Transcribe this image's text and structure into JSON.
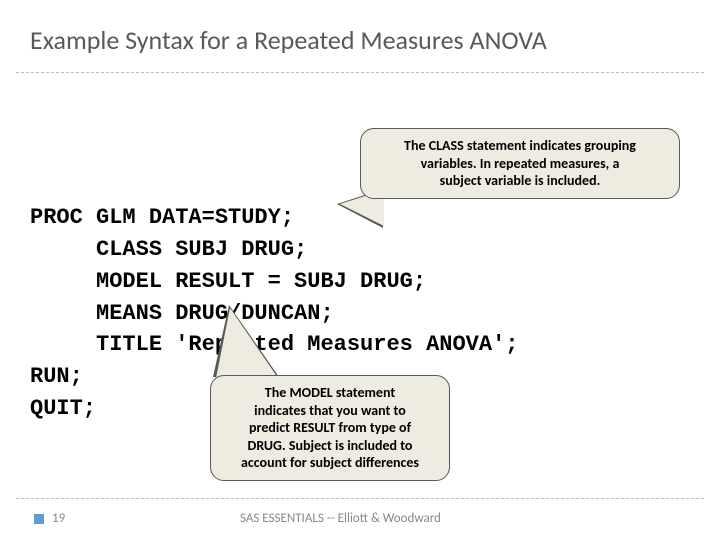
{
  "title": "Example Syntax for a Repeated Measures ANOVA",
  "code": {
    "l1": "PROC GLM DATA=STUDY;",
    "l2": "     CLASS SUBJ DRUG;",
    "l3": "     MODEL RESULT = SUBJ DRUG;",
    "l4": "     MEANS DRUG/DUNCAN;",
    "l5": "     TITLE 'Repeated Measures ANOVA';",
    "l6": "RUN;",
    "l7": "QUIT;"
  },
  "callout1": {
    "line1": "The CLASS statement indicates grouping",
    "line2": "variables. In repeated measures, a",
    "line3": "subject variable is included."
  },
  "callout2": {
    "line1": "The MODEL statement",
    "line2": "indicates that you want to",
    "line3": "predict RESULT from type of",
    "line4": "DRUG. Subject is included to",
    "line5": "account for subject differences"
  },
  "footer": {
    "page": "19",
    "text": "SAS ESSENTIALS -- Elliott & Woodward"
  }
}
